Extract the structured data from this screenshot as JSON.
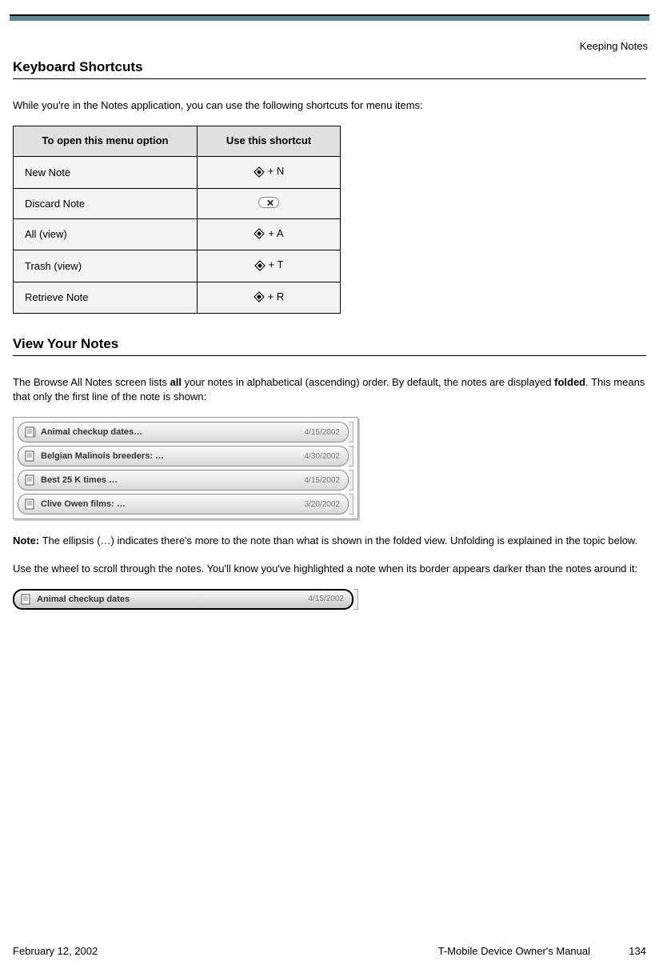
{
  "chapter": "Keeping Notes",
  "section1_title": "Keyboard Shortcuts",
  "section1_intro": "While you're in the Notes application, you can use the following shortcuts for menu items:",
  "table": {
    "header1": "To open this menu option",
    "header2": "Use this shortcut",
    "rows": [
      {
        "label": "New Note",
        "type": "diamond",
        "key": "+ N"
      },
      {
        "label": "Discard Note",
        "type": "discard",
        "key": ""
      },
      {
        "label": "All (view)",
        "type": "diamond",
        "key": "+ A"
      },
      {
        "label": "Trash (view)",
        "type": "diamond",
        "key": "+ T"
      },
      {
        "label": "Retrieve Note",
        "type": "diamond",
        "key": "+ R"
      }
    ]
  },
  "section2_title": "View Your Notes",
  "section2_p1a": "The Browse All Notes screen lists ",
  "section2_p1_bold1": "all",
  "section2_p1b": " your notes in alphabetical (ascending) order. By default, the notes are displayed ",
  "section2_p1_bold2": "folded",
  "section2_p1c": ". This means that only the first line of the note is shown:",
  "notes_list": [
    {
      "title": "Animal checkup dates…",
      "date": "4/15/2002"
    },
    {
      "title": "Belgian Malinois breeders: …",
      "date": "4/30/2002"
    },
    {
      "title": "Best 25 K times …",
      "date": "4/15/2002"
    },
    {
      "title": "Clive Owen films: …",
      "date": "3/20/2002"
    }
  ],
  "note_p2_bold": "Note:",
  "note_p2": " The ellipsis (…) indicates there's more to the note than what is shown in the folded view. Unfolding is explained in the topic below.",
  "note_p3": "Use the wheel to scroll through the notes. You'll know you've highlighted a note when its border appears darker than the notes around it:",
  "selected_note": {
    "title": "Animal checkup dates",
    "date": "4/15/2002"
  },
  "footer": {
    "date": "February 12, 2002",
    "manual": "T-Mobile Device Owner's Manual",
    "page": "134"
  }
}
